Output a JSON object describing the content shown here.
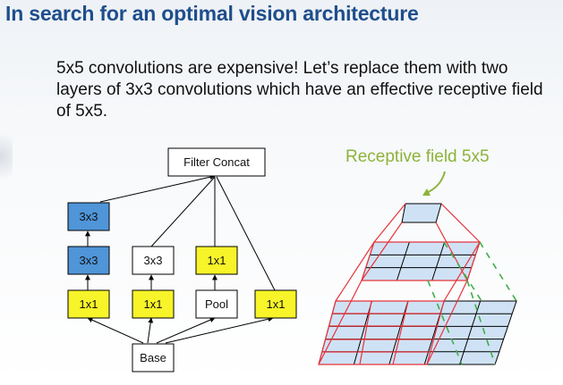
{
  "slide": {
    "title": "In search for an optimal vision architecture",
    "subtitle": "5x5 convolutions are expensive! Let’s replace them with two layers of 3x3 convolutions which have an effective receptive field of 5x5."
  },
  "inception": {
    "concat_label": "Filter Concat",
    "base_label": "Base",
    "col1": {
      "top": "3x3",
      "mid": "3x3",
      "bottom": "1x1"
    },
    "col2": {
      "mid": "3x3",
      "bottom": "1x1"
    },
    "col3": {
      "mid": "1x1",
      "bottom": "Pool"
    },
    "col4": {
      "bottom": "1x1"
    }
  },
  "receptive": {
    "label": "Receptive field 5x5"
  },
  "colors": {
    "title": "#1f4e8c",
    "blue_box": "#4f95d8",
    "yellow_box": "#f7f429",
    "label_green": "#8db33b",
    "grid_fill": "#cfe2f5",
    "red_line": "#e8323a",
    "green_dash": "#3fae4b"
  }
}
